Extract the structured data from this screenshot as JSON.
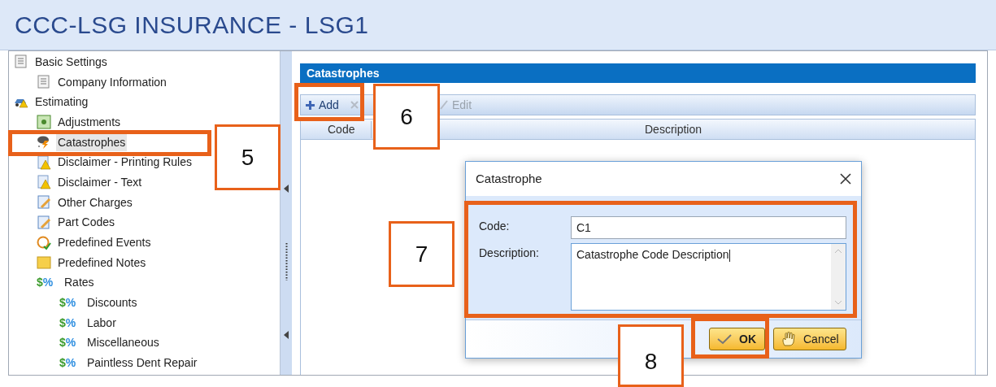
{
  "window": {
    "title": "CCC-LSG INSURANCE - LSG1"
  },
  "tree": [
    {
      "label": "Basic Settings",
      "kind": "document",
      "selected": false,
      "children": [
        {
          "label": "Company Information",
          "kind": "document",
          "selected": false
        }
      ]
    },
    {
      "label": "Estimating",
      "kind": "car",
      "selected": false,
      "children": [
        {
          "label": "Adjustments",
          "kind": "money",
          "selected": false
        },
        {
          "label": "Catastrophes",
          "kind": "storm",
          "selected": true
        },
        {
          "label": "Disclaimer - Printing Rules",
          "kind": "warning",
          "selected": false
        },
        {
          "label": "Disclaimer - Text",
          "kind": "warning",
          "selected": false
        },
        {
          "label": "Other Charges",
          "kind": "pencil",
          "selected": false
        },
        {
          "label": "Part Codes",
          "kind": "pencil",
          "selected": false
        },
        {
          "label": "Predefined Events",
          "kind": "clock",
          "selected": false
        },
        {
          "label": "Predefined Notes",
          "kind": "note",
          "selected": false
        },
        {
          "label": "Rates",
          "kind": "rates",
          "symbol": "$%",
          "selected": false,
          "children": [
            {
              "label": "Discounts",
              "kind": "rates",
              "symbol": "$%",
              "selected": false
            },
            {
              "label": "Labor",
              "kind": "rates",
              "symbol": "$%",
              "selected": false
            },
            {
              "label": "Miscellaneous",
              "kind": "rates",
              "symbol": "$%",
              "selected": false
            },
            {
              "label": "Paintless Dent Repair",
              "kind": "rates",
              "symbol": "$%",
              "selected": false
            }
          ]
        }
      ]
    }
  ],
  "panel": {
    "title": "Catastrophes",
    "toolbar": [
      {
        "kind": "add",
        "label": "Add",
        "disabled": false
      },
      {
        "kind": "delete",
        "disabled": true
      },
      {
        "kind": "edit",
        "label": "Edit",
        "disabled": true
      }
    ],
    "columns": [
      "Code",
      "Description"
    ]
  },
  "dialog": {
    "title": "Catastrophe",
    "fields": [
      {
        "kind": "line",
        "label": "Code:",
        "value": "C1"
      },
      {
        "kind": "area",
        "label": "Description:",
        "value": "Catastrophe Code Description"
      }
    ],
    "buttons": [
      {
        "kind": "ok",
        "label": "OK"
      },
      {
        "kind": "cancel",
        "label": "Cancel"
      }
    ]
  },
  "callouts": [
    {
      "number": "5"
    },
    {
      "number": "6"
    },
    {
      "number": "7"
    },
    {
      "number": "8"
    }
  ]
}
